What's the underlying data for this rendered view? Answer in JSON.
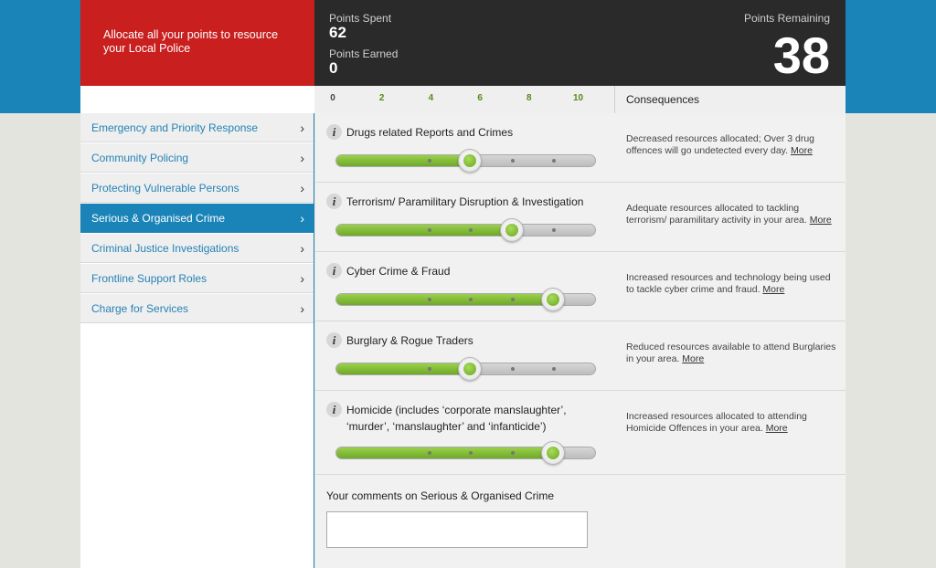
{
  "header": {
    "instruction": "Allocate all your points to resource your Local Police",
    "points_spent_label": "Points Spent",
    "points_spent": "62",
    "points_earned_label": "Points Earned",
    "points_earned": "0",
    "points_remaining_label": "Points Remaining",
    "points_remaining": "38"
  },
  "scale": {
    "ticks": [
      "0",
      "2",
      "4",
      "6",
      "8",
      "10"
    ],
    "min": 0,
    "max": 10
  },
  "consequences_heading": "Consequences",
  "sidebar": {
    "items": [
      {
        "label": "Emergency and Priority Response",
        "active": false
      },
      {
        "label": "Community Policing",
        "active": false
      },
      {
        "label": "Protecting Vulnerable Persons",
        "active": false
      },
      {
        "label": "Serious & Organised Crime",
        "active": true
      },
      {
        "label": "Criminal Justice Investigations",
        "active": false
      },
      {
        "label": "Frontline Support Roles",
        "active": false
      },
      {
        "label": "Charge for Services",
        "active": false
      }
    ],
    "chevron": "›"
  },
  "rows": [
    {
      "title": "Drugs related Reports and Crimes",
      "value": 4,
      "consequence": "Decreased resources allocated; Over 3 drug offences will go undetected every day.",
      "more": "More"
    },
    {
      "title": "Terrorism/ Paramilitary Disruption & Investigation",
      "value": 6,
      "consequence": "Adequate resources allocated to tackling terrorism/ paramilitary activity in your area.",
      "more": "More"
    },
    {
      "title": "Cyber Crime & Fraud",
      "value": 8,
      "consequence": "Increased resources and technology being used to tackle cyber crime and fraud.",
      "more": "More"
    },
    {
      "title": "Burglary & Rogue Traders",
      "value": 4,
      "consequence": "Reduced resources available to attend Burglaries in your area.",
      "more": "More"
    },
    {
      "title": "Homicide (includes ‘corporate manslaughter’, ‘murder’, ‘manslaughter’ and ‘infanticide’)",
      "value": 8,
      "consequence": "Increased resources allocated to attending Homicide Offences in your area.",
      "more": "More"
    }
  ],
  "info_icon": "i",
  "comments": {
    "label": "Your comments on Serious & Organised Crime",
    "value": ""
  },
  "colors": {
    "accent_blue": "#1a84b8",
    "red": "#c91f1f",
    "dark": "#2a2a2a",
    "green": "#7cb832"
  }
}
